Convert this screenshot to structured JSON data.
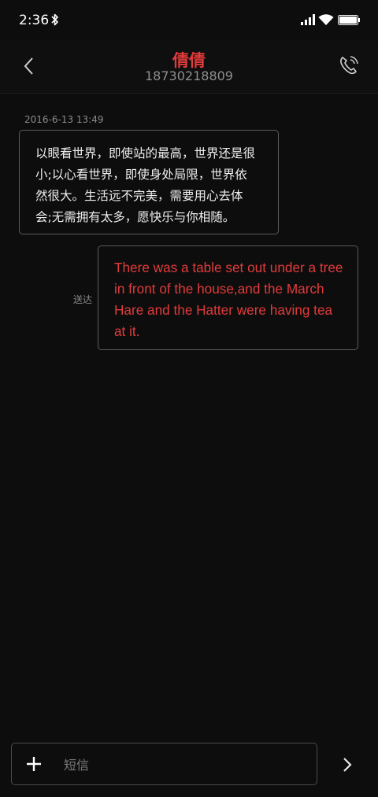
{
  "status_bar": {
    "time": "2:36"
  },
  "header": {
    "title": "倩倩",
    "subtitle": "18730218809"
  },
  "conversation": {
    "timestamp": "2016-6-13 13:49",
    "incoming_lines": [
      "以眼看世界，即使站的最高，世界还是很",
      "小;以心看世界，即使身处局限，世界依",
      "然很大。生活远不完美，需要用心去体",
      "会;无需拥有太多，愿快乐与你相随。"
    ],
    "outgoing_lines": [
      "There was a table set out under a tree",
      "in front of the house,and the March",
      "Hare and the Hatter were having tea",
      "at it."
    ],
    "sent_status": "送达"
  },
  "composer": {
    "placeholder": "短信"
  },
  "colors": {
    "accent": "#e23b3b",
    "background": "#0d0d0d",
    "bubble_border": "#5b5b5b"
  },
  "icons": {
    "back": "chevron-left-icon",
    "call": "phone-icon",
    "add": "plus-icon",
    "send": "chevron-right-icon"
  }
}
